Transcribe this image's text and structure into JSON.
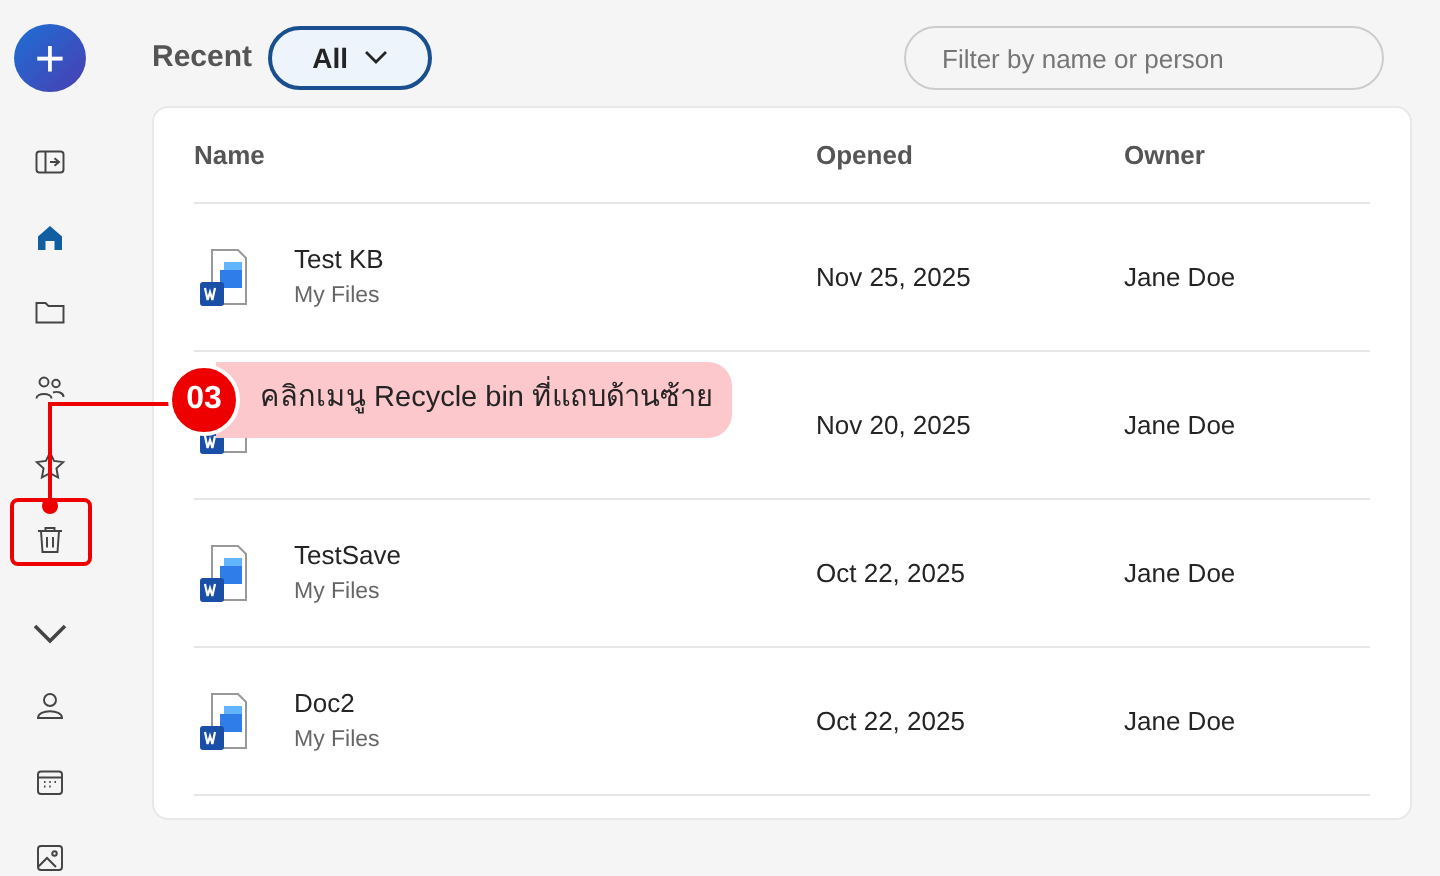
{
  "new_button": {
    "label": "+"
  },
  "sidebar": {
    "items": [
      {
        "selected": false
      },
      {
        "selected": true
      },
      {
        "selected": false
      },
      {
        "selected": false
      },
      {
        "selected": false
      },
      {
        "selected": false
      },
      {
        "selected": false
      },
      {
        "selected": false
      },
      {
        "selected": false
      },
      {
        "selected": false
      }
    ]
  },
  "header": {
    "title": "Recent",
    "filter_button": "All",
    "search": {
      "placeholder": "Filter by name or person"
    }
  },
  "table": {
    "columns": [
      "Name",
      "Opened",
      "Owner"
    ],
    "rows": [
      {
        "name": "Test KB",
        "location": "My Files",
        "opened": "Nov 25, 2025",
        "owner": "Jane Doe"
      },
      {
        "opened": "Nov 20, 2025",
        "owner": "Jane Doe"
      },
      {
        "name": "TestSave",
        "location": "My Files",
        "opened": "Oct 22, 2025",
        "owner": "Jane Doe"
      },
      {
        "name": "Doc2",
        "location": "My Files",
        "opened": "Oct 22, 2025",
        "owner": "Jane Doe"
      }
    ]
  },
  "callout": {
    "number": "03",
    "text": "คลิกเมนู Recycle bin ที่แถบด้านซ้าย"
  }
}
